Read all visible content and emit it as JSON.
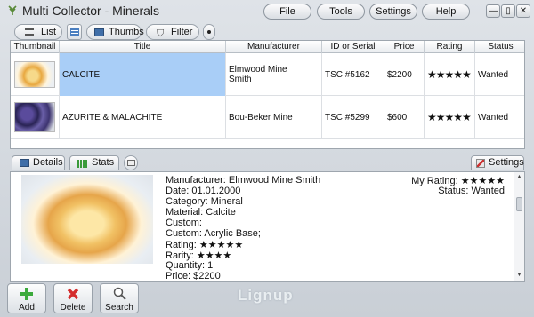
{
  "window": {
    "title": "Multi Collector - Minerals"
  },
  "menu": {
    "file": "File",
    "tools": "Tools",
    "settings": "Settings",
    "help": "Help"
  },
  "window_controls": {
    "minimize": "—",
    "restore": "▯",
    "close": "✕"
  },
  "toolbar": {
    "list": "List",
    "thumbs": "Thumbs",
    "filter": "Filter"
  },
  "grid": {
    "columns": [
      "Thumbnail",
      "Title",
      "Manufacturer",
      "ID or Serial",
      "Price",
      "Rating",
      "Status"
    ],
    "rows": [
      {
        "title": "CALCITE",
        "manufacturer_line1": "Elmwood Mine",
        "manufacturer_line2": "Smith",
        "id": "TSC #5162",
        "price": "$2200",
        "rating": "★★★★★",
        "status": "Wanted"
      },
      {
        "title": "AZURITE & MALACHITE",
        "manufacturer_line1": "Bou-Beker Mine",
        "manufacturer_line2": "",
        "id": "TSC #5299",
        "price": "$600",
        "rating": "★★★★★",
        "status": "Wanted"
      }
    ]
  },
  "tabs": {
    "details": "Details",
    "stats": "Stats",
    "settings": "Settings"
  },
  "details": {
    "lines": [
      "Manufacturer: Elmwood Mine Smith",
      "Date: 01.01.2000",
      "Category: Mineral",
      "Material: Calcite",
      "Custom:",
      "Custom: Acrylic Base;",
      "Rating: ★★★★★",
      "Rarity: ★★★★",
      "Quantity: 1",
      "Price: $2200"
    ],
    "my_rating": "My Rating: ★★★★★",
    "status": "Status: Wanted"
  },
  "bottom": {
    "add": "Add",
    "delete": "Delete",
    "search": "Search",
    "logo": "Lignup"
  },
  "colors": {
    "selection": "#a9cef7",
    "add_green": "#3caa3c",
    "delete_red": "#d42c2c"
  }
}
